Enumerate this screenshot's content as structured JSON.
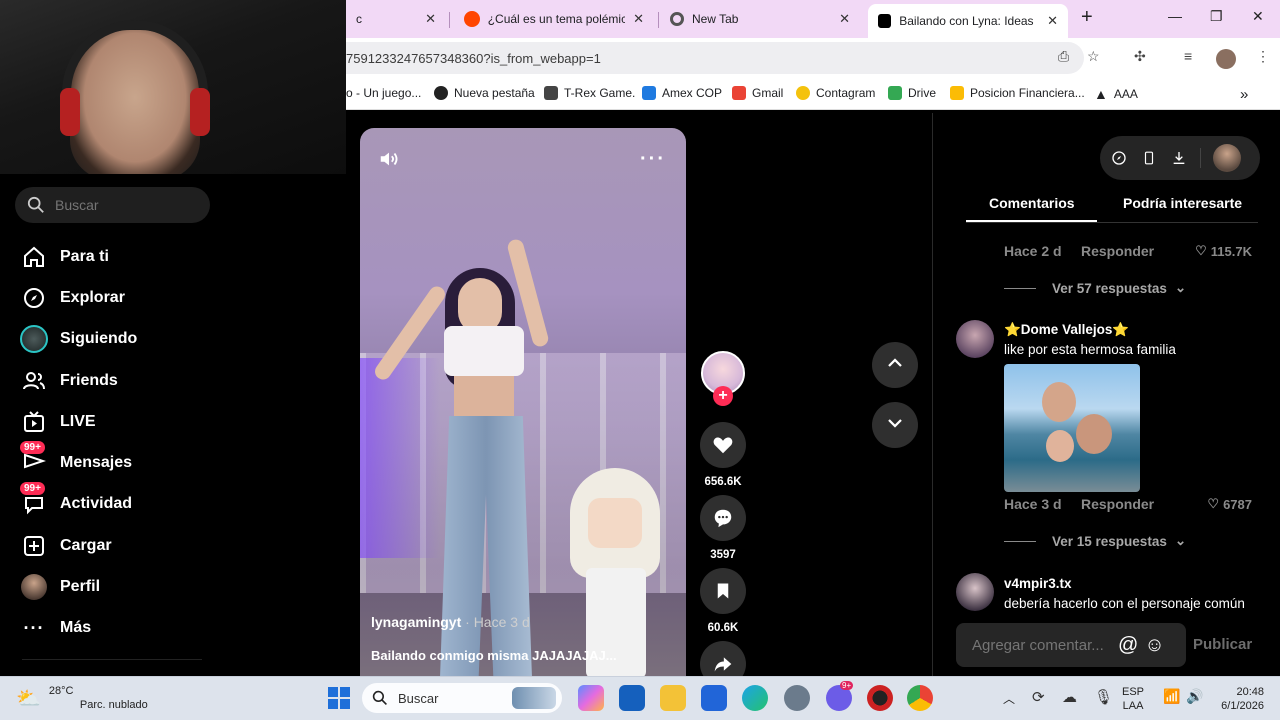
{
  "browser": {
    "tabs": [
      {
        "title": "c"
      },
      {
        "title": "¿Cuál es un tema polémico s"
      },
      {
        "title": "New Tab"
      },
      {
        "title": "Bailando con Lyna: Ideas"
      }
    ],
    "url": "7591233247657348360?is_from_webapp=1",
    "bookmarks": [
      "o - Un juego...",
      "Nueva pestaña",
      "T-Rex Game.",
      "Amex COP",
      "Gmail",
      "Contagram",
      "Drive",
      "Posicion Financiera...",
      "AAA"
    ]
  },
  "sidebar": {
    "search_placeholder": "Buscar",
    "items": [
      {
        "label": "Para ti",
        "icon": "home-icon"
      },
      {
        "label": "Explorar",
        "icon": "compass-icon"
      },
      {
        "label": "Siguiendo",
        "icon": "following-avatar-icon"
      },
      {
        "label": "Friends",
        "icon": "friends-icon"
      },
      {
        "label": "LIVE",
        "icon": "live-tv-icon"
      },
      {
        "label": "Mensajes",
        "icon": "messages-icon",
        "badge": "99+"
      },
      {
        "label": "Actividad",
        "icon": "activity-icon",
        "badge": "99+"
      },
      {
        "label": "Cargar",
        "icon": "upload-plus-icon"
      },
      {
        "label": "Perfil",
        "icon": "profile-avatar-icon"
      },
      {
        "label": "Más",
        "icon": "more-dots-icon"
      }
    ]
  },
  "video": {
    "author": "lynagamingyt",
    "time": " · Hace 3 d",
    "caption": "Bailando conmigo misma JAJAJAJAJ...",
    "likes": "656.6K",
    "comments": "3597",
    "saves": "60.6K"
  },
  "comments_panel": {
    "tab_comments": "Comentarios",
    "tab_interest": "Podría interesarte",
    "items": [
      {
        "time": "Hace 2 d",
        "reply": "Responder",
        "likes": "115.7K",
        "more": "Ver 57 respuestas"
      },
      {
        "user": "⭐Dome Vallejos⭐",
        "text": "like por esta hermosa familia",
        "time": "Hace 3 d",
        "reply": "Responder",
        "likes": "6787",
        "more": "Ver 15 respuestas"
      },
      {
        "user": "v4mpir3.tx",
        "text": "debería hacerlo con el personaje común"
      }
    ],
    "input_placeholder": "Agregar comentar...",
    "publish": "Publicar"
  },
  "taskbar": {
    "temp": "28°C",
    "weather": "Parc. nublado",
    "search": "Buscar",
    "lang1": "ESP",
    "lang2": "LAA",
    "time": "20:48",
    "date": "6/1/2026",
    "notif": "9+"
  },
  "colors": {
    "accent": "#fe2c55",
    "tab_bar": "#f2d9f6"
  }
}
